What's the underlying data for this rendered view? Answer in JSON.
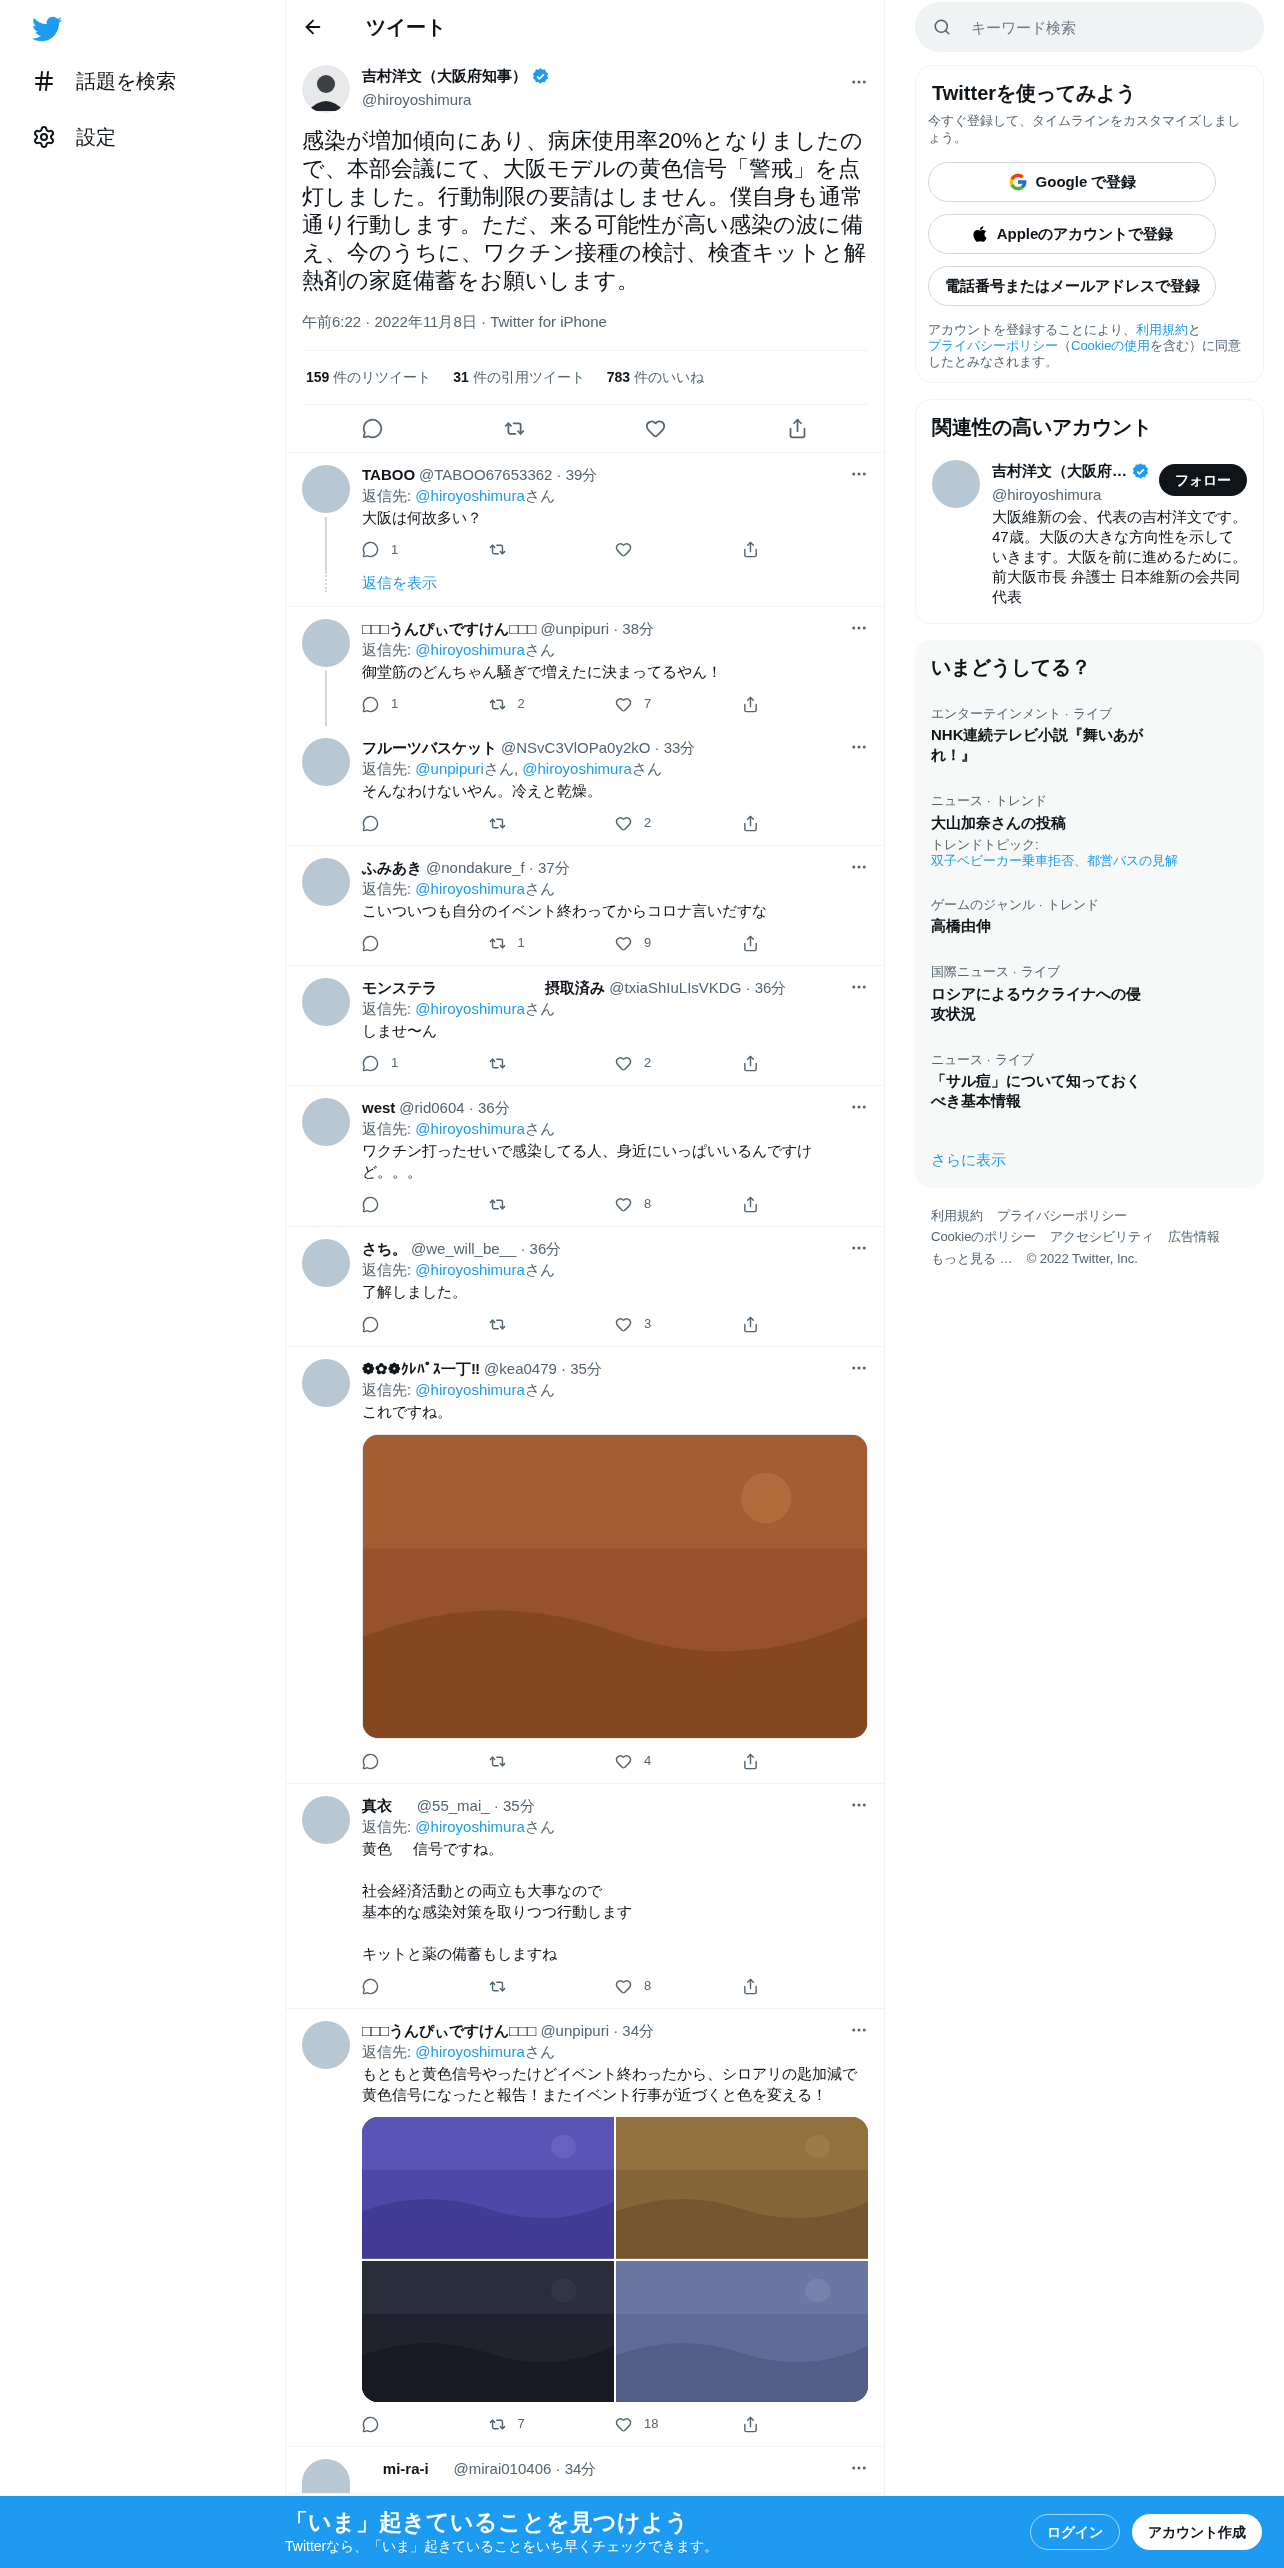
{
  "nav": {
    "items": [
      {
        "label": "話題を検索",
        "kind": "hash"
      },
      {
        "label": "設定",
        "kind": "gear"
      }
    ]
  },
  "header": {
    "title": "ツイート"
  },
  "tweet": {
    "name": "吉村洋文（大阪府知事）",
    "verified": true,
    "handle": "@hiroyoshimura",
    "text": "感染が増加傾向にあり、病床使用率20%となりましたので、本部会議にて、大阪モデルの黄色信号「警戒」を点灯しました。行動制限の要請はしません。僕自身も通常通り行動します。ただ、来る可能性が高い感染の波に備え、今のうちに、ワクチン接種の検討、検査キットと解熱剤の家庭備蓄をお願いします。",
    "meta": "午前6:22 · 2022年11月8日 · Twitter for iPhone",
    "stats": [
      {
        "count": "159",
        "label": "件のリツイート"
      },
      {
        "count": "31",
        "label": "件の引用ツイート"
      },
      {
        "count": "783",
        "label": "件のいいね"
      }
    ]
  },
  "replies": [
    {
      "name": "TABOO",
      "meta": "@TABOO67653362 · 39分",
      "reply_to": [
        {
          "text": "返信先: ",
          "kind": "plain"
        },
        {
          "text": "@hiroyoshimura",
          "kind": "link"
        },
        {
          "text": "さん",
          "kind": "plain"
        }
      ],
      "text": "大阪は何故多い？",
      "stats": {
        "replies": "1"
      },
      "thread_continues": true,
      "show_replies": "返信を表示"
    },
    {
      "name": "□□□うんぴぃですけん□□□",
      "meta": "@unpipuri · 38分",
      "reply_to": [
        {
          "text": "返信先: ",
          "kind": "plain"
        },
        {
          "text": "@hiroyoshimura",
          "kind": "link"
        },
        {
          "text": "さん",
          "kind": "plain"
        }
      ],
      "text": "御堂筋のどんちゃん騒ぎで増えたに決まってるやん！",
      "stats": {
        "replies": "1",
        "retweets": "2",
        "likes": "7"
      },
      "thread_continues": true
    },
    {
      "name": "フルーツバスケット",
      "meta": "@NSvC3VlOPa0y2kO · 33分",
      "reply_to": [
        {
          "text": "返信先: ",
          "kind": "plain"
        },
        {
          "text": "@unpipuri",
          "kind": "link"
        },
        {
          "text": "さん, ",
          "kind": "plain"
        },
        {
          "text": "@hiroyoshimura",
          "kind": "link"
        },
        {
          "text": "さん",
          "kind": "plain"
        }
      ],
      "text": "そんなわけないやん。冷えと乾燥。",
      "stats": {
        "likes": "2"
      },
      "thread_continues": false
    },
    {
      "name": "ふみあき",
      "meta": "@nondakure_f · 37分",
      "reply_to": [
        {
          "text": "返信先: ",
          "kind": "plain"
        },
        {
          "text": "@hiroyoshimura",
          "kind": "link"
        },
        {
          "text": "さん",
          "kind": "plain"
        }
      ],
      "text": "こいついつも自分のイベント終わってからコロナ言いだすな",
      "stats": {
        "retweets": "1",
        "likes": "9"
      },
      "thread_continues": false
    },
    {
      "name": "モンステラ                          摂取済み",
      "meta": "@txiaShIuLIsVKDG · 36分",
      "reply_to": [
        {
          "text": "返信先: ",
          "kind": "plain"
        },
        {
          "text": "@hiroyoshimura",
          "kind": "link"
        },
        {
          "text": "さん",
          "kind": "plain"
        }
      ],
      "text": "しませ〜ん",
      "stats": {
        "replies": "1",
        "likes": "2"
      },
      "thread_continues": false
    },
    {
      "name": "west",
      "meta": "@rid0604 · 36分",
      "reply_to": [
        {
          "text": "返信先: ",
          "kind": "plain"
        },
        {
          "text": "@hiroyoshimura",
          "kind": "link"
        },
        {
          "text": "さん",
          "kind": "plain"
        }
      ],
      "text": "ワクチン打ったせいで感染してる人、身近にいっぱいいるんですけど。。。",
      "stats": {
        "likes": "8"
      },
      "thread_continues": false
    },
    {
      "name": "さち。",
      "meta": "@we_will_be__ · 36分",
      "reply_to": [
        {
          "text": "返信先: ",
          "kind": "plain"
        },
        {
          "text": "@hiroyoshimura",
          "kind": "link"
        },
        {
          "text": "さん",
          "kind": "plain"
        }
      ],
      "text": "了解しました。",
      "stats": {
        "likes": "3"
      },
      "thread_continues": false
    },
    {
      "name": "❁✿❁ｸﾚﾊﾟｽ一丁‼",
      "meta": "@kea0479 · 35分",
      "reply_to": [
        {
          "text": "返信先: ",
          "kind": "plain"
        },
        {
          "text": "@hiroyoshimura",
          "kind": "link"
        },
        {
          "text": "さん",
          "kind": "plain"
        }
      ],
      "text": "これですね。",
      "media": [
        {
          "kind": "picture"
        }
      ],
      "stats": {
        "likes": "4"
      },
      "thread_continues": false
    },
    {
      "name": "真衣     ",
      "meta": "@55_mai_ · 35分",
      "reply_to": [
        {
          "text": "返信先: ",
          "kind": "plain"
        },
        {
          "text": "@hiroyoshimura",
          "kind": "link"
        },
        {
          "text": "さん",
          "kind": "plain"
        }
      ],
      "paragraphs": [
        [
          "黄色     信号ですね。"
        ],
        [
          "社会経済活動との両立も大事なので",
          "基本的な感染対策を取りつつ行動します"
        ],
        [
          "キットと薬の備蓄もしますね"
        ]
      ],
      "stats": {
        "likes": "8"
      },
      "thread_continues": false
    },
    {
      "name": "□□□うんぴぃですけん□□□",
      "meta": "@unpipuri · 34分",
      "reply_to": [
        {
          "text": "返信先: ",
          "kind": "plain"
        },
        {
          "text": "@hiroyoshimura",
          "kind": "link"
        },
        {
          "text": "さん",
          "kind": "plain"
        }
      ],
      "text": "もともと黄色信号やったけどイベント終わったから、シロアリの匙加減で黄色信号になったと報告！またイベント行事が近づくと色を変える！",
      "media": [
        {
          "kind": "picture"
        },
        {
          "kind": "picture"
        },
        {
          "kind": "picture"
        },
        {
          "kind": "picture"
        }
      ],
      "stats": {
        "retweets": "7",
        "likes": "18"
      },
      "thread_continues": false
    },
    {
      "name": "     mi-ra-i     ",
      "meta": "@mirai010406 · 34分",
      "thread_continues": false
    }
  ],
  "search": {
    "placeholder": "キーワード検索"
  },
  "signup": {
    "title": "Twitterを使ってみよう",
    "subtitle": "今すぐ登録して、タイムラインをカスタマイズしましょう。",
    "buttons": [
      {
        "label": "Google で登録",
        "kind": "google"
      },
      {
        "label": "Appleのアカウントで登録",
        "kind": "apple"
      },
      {
        "label": "電話番号またはメールアドレスで登録",
        "kind": "plain"
      }
    ],
    "legal": [
      {
        "text": "アカウントを登録することにより、",
        "kind": "plain"
      },
      {
        "text": "利用規約",
        "kind": "link"
      },
      {
        "text": "と",
        "kind": "plain"
      },
      {
        "text": "プライバシーポリシー",
        "kind": "link"
      },
      {
        "text": "（",
        "kind": "plain"
      },
      {
        "text": "Cookieの使用",
        "kind": "link"
      },
      {
        "text": "を含む）に同意したとみなされます。",
        "kind": "plain"
      }
    ]
  },
  "related": {
    "title": "関連性の高いアカウント",
    "accounts": [
      {
        "name": "吉村洋文（大阪府…",
        "verified": true,
        "handle": "@hiroyoshimura",
        "follow": "フォロー",
        "bio": "大阪維新の会、代表の吉村洋文です。47歳。大阪の大きな方向性を示していきます。大阪を前に進めるために。前大阪市長 弁護士 日本維新の会共同代表"
      }
    ]
  },
  "trends": {
    "title": "いまどうしてる？",
    "items": [
      {
        "category": "エンターテインメント · ライブ",
        "title": "NHK連続テレビ小説『舞いあがれ！』"
      },
      {
        "category": "ニュース · トレンド",
        "title": "大山加奈さんの投稿",
        "topic": [
          {
            "text": "トレンドトピック: ",
            "kind": "plain"
          },
          {
            "text": "双子ベビーカー乗車拒否、都営バスの見解",
            "kind": "link"
          }
        ]
      },
      {
        "category": "ゲームのジャンル · トレンド",
        "title": "高橋由伸"
      },
      {
        "category": "国際ニュース · ライブ",
        "title": "ロシアによるウクライナへの侵攻状況"
      },
      {
        "category": "ニュース · ライブ",
        "title": "「サル痘」について知っておくべき基本情報"
      }
    ],
    "more": "さらに表示"
  },
  "footer": {
    "links": [
      "利用規約",
      "プライバシーポリシー",
      "Cookieのポリシー",
      "アクセシビリティ",
      "広告情報",
      "もっと見る …",
      "© 2022 Twitter, Inc."
    ]
  },
  "banner": {
    "title": "「いま」起きていることを見つけよう",
    "subtitle": "Twitterなら、「いま」起きていることをいち早くチェックできます。",
    "login": "ログイン",
    "signup": "アカウント作成"
  }
}
